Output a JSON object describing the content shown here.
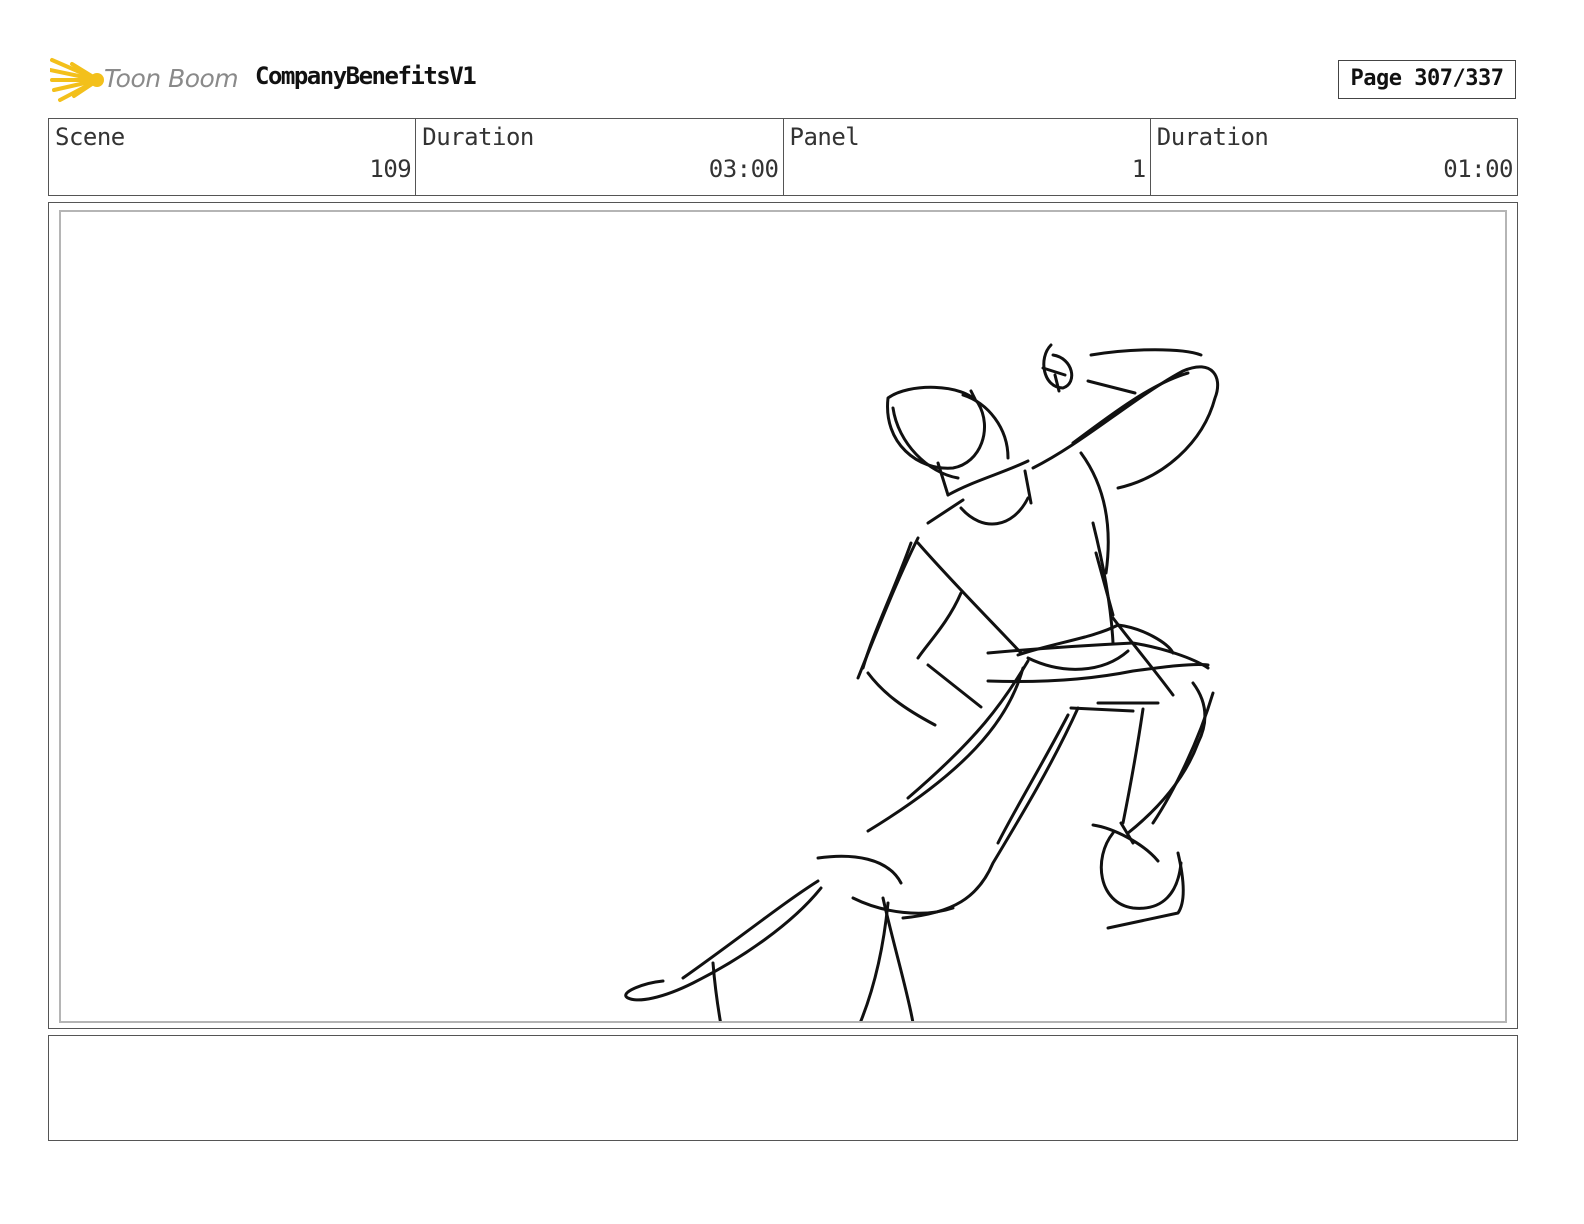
{
  "header": {
    "brand": "Toon Boom",
    "project_title": "CompanyBenefitsV1",
    "page_label": "Page 307/337"
  },
  "info": [
    {
      "label": "Scene",
      "value": "109"
    },
    {
      "label": "Duration",
      "value": "03:00"
    },
    {
      "label": "Panel",
      "value": "1"
    },
    {
      "label": "Duration",
      "value": "01:00"
    }
  ],
  "panel": {
    "content": "sketch"
  },
  "notes": {
    "text": ""
  }
}
